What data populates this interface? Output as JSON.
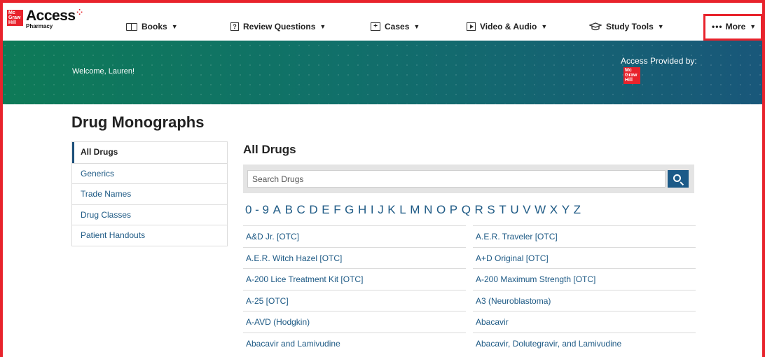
{
  "brand": {
    "mgh_lines": [
      "Mc",
      "Graw",
      "Hill"
    ],
    "product": "Access",
    "subproduct": "Pharmacy"
  },
  "nav": {
    "items": [
      {
        "label": "Books",
        "icon": "book-icon"
      },
      {
        "label": "Review Questions",
        "icon": "question-icon"
      },
      {
        "label": "Cases",
        "icon": "case-icon"
      },
      {
        "label": "Video & Audio",
        "icon": "play-icon"
      },
      {
        "label": "Study Tools",
        "icon": "graduation-cap-icon"
      }
    ],
    "more_label": "More",
    "more_icon": "ellipsis-icon"
  },
  "banner": {
    "welcome": "Welcome, Lauren!",
    "provided_by": "Access Provided by:",
    "provider_logo_lines": [
      "Mc",
      "Graw",
      "Hill"
    ]
  },
  "page": {
    "title": "Drug Monographs"
  },
  "sidenav": {
    "items": [
      "All Drugs",
      "Generics",
      "Trade Names",
      "Drug Classes",
      "Patient Handouts"
    ],
    "active": "All Drugs"
  },
  "main": {
    "heading": "All Drugs",
    "search_placeholder": "Search Drugs",
    "alphabet": [
      "0 - 9",
      "A",
      "B",
      "C",
      "D",
      "E",
      "F",
      "G",
      "H",
      "I",
      "J",
      "K",
      "L",
      "M",
      "N",
      "O",
      "P",
      "Q",
      "R",
      "S",
      "T",
      "U",
      "V",
      "W",
      "X",
      "Y",
      "Z"
    ],
    "drugs": [
      "A&D Jr. [OTC]",
      "A.E.R. Traveler [OTC]",
      "A.E.R. Witch Hazel [OTC]",
      "A+D Original [OTC]",
      "A-200 Lice Treatment Kit [OTC]",
      "A-200 Maximum Strength [OTC]",
      "A-25 [OTC]",
      "A3 (Neuroblastoma)",
      "A-AVD (Hodgkin)",
      "Abacavir",
      "Abacavir and Lamivudine",
      "Abacavir, Dolutegravir, and Lamivudine"
    ]
  },
  "colors": {
    "highlight": "#e8232c",
    "link": "#1e5a85",
    "banner_start": "#0e7a57",
    "banner_end": "#19577a",
    "search_button": "#1c5a88"
  }
}
